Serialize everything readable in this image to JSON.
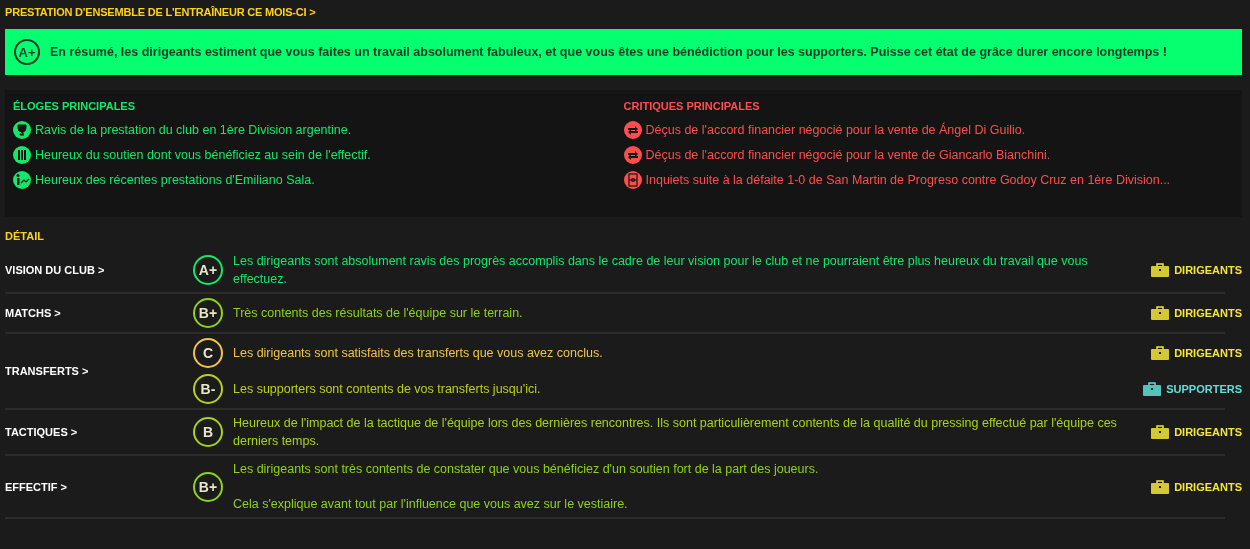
{
  "title": "PRESTATION D'ENSEMBLE DE L'ENTRAÎNEUR CE MOIS-CI >",
  "summary": {
    "grade": "A+",
    "text": "En résumé, les dirigeants estiment que vous faites un travail absolument fabuleux, et que vous êtes une bénédiction pour les supporters. Puisse cet état de grâce durer encore longtemps !"
  },
  "praise": {
    "heading": "ÉLOGES PRINCIPALES",
    "items": [
      {
        "kind": "trophy",
        "text": "Ravis de la prestation du club en 1ère Division argentine."
      },
      {
        "kind": "squad",
        "text": "Heureux du soutien dont vous bénéficiez au sein de l'effectif."
      },
      {
        "kind": "player",
        "text": "Heureux des récentes prestations d'Emiliano Sala."
      }
    ]
  },
  "criticism": {
    "heading": "CRITIQUES PRINCIPALES",
    "items": [
      {
        "kind": "transfer",
        "text": "Déçus de l'accord financier négocié pour la vente de Ángel Di Guilio."
      },
      {
        "kind": "transfer",
        "text": "Déçus de l'accord financier négocié pour la vente de Giancarlo Bianchini."
      },
      {
        "kind": "pitch",
        "text": "Inquiets suite à la défaite 1-0 de San Martin de Progreso contre Godoy Cruz en 1ère Division..."
      }
    ]
  },
  "detail": {
    "heading": "DÉTAIL",
    "rows": [
      {
        "label": "VISION DU CLUB >",
        "statements": [
          {
            "grade": "A+",
            "color": "#13e86a",
            "paragraphs": [
              "Les dirigeants sont absolument ravis des progrès accomplis dans le cadre de leur vision pour le club et ne pourraient être plus heureux du travail que vous effectuez."
            ],
            "source": {
              "kind": "board",
              "label": "DIRIGEANTS"
            }
          }
        ]
      },
      {
        "label": "MATCHS >",
        "statements": [
          {
            "grade": "B+",
            "color": "#8ed21a",
            "paragraphs": [
              "Très contents des résultats de l'équipe sur le terrain."
            ],
            "source": {
              "kind": "board",
              "label": "DIRIGEANTS"
            }
          }
        ]
      },
      {
        "label": "TRANSFERTS >",
        "statements": [
          {
            "grade": "C",
            "color": "#f2c44a",
            "paragraphs": [
              "Les dirigeants sont satisfaits des transferts que vous avez conclus."
            ],
            "source": {
              "kind": "board",
              "label": "DIRIGEANTS"
            }
          },
          {
            "grade": "B-",
            "color": "#b8d21a",
            "paragraphs": [
              "Les supporters sont contents de vos transferts jusqu'ici."
            ],
            "source": {
              "kind": "supporters",
              "label": "SUPPORTERS"
            }
          }
        ]
      },
      {
        "label": "TACTIQUES >",
        "statements": [
          {
            "grade": "B",
            "color": "#a8d21a",
            "paragraphs": [
              "Heureux de l'impact de la tactique de l'équipe lors des dernières rencontres. Ils sont particulièrement contents de la qualité du pressing effectué par l'équipe ces derniers temps."
            ],
            "source": {
              "kind": "board",
              "label": "DIRIGEANTS"
            }
          }
        ]
      },
      {
        "label": "EFFECTIF >",
        "statements": [
          {
            "grade": "B+",
            "color": "#8ed21a",
            "paragraphs": [
              "Les dirigeants sont très contents de constater que vous bénéficiez d'un soutien fort de la part des joueurs.",
              "Cela s'explique avant tout par l'influence que vous avez sur le vestiaire."
            ],
            "source": {
              "kind": "board",
              "label": "DIRIGEANTS"
            }
          }
        ]
      }
    ]
  }
}
